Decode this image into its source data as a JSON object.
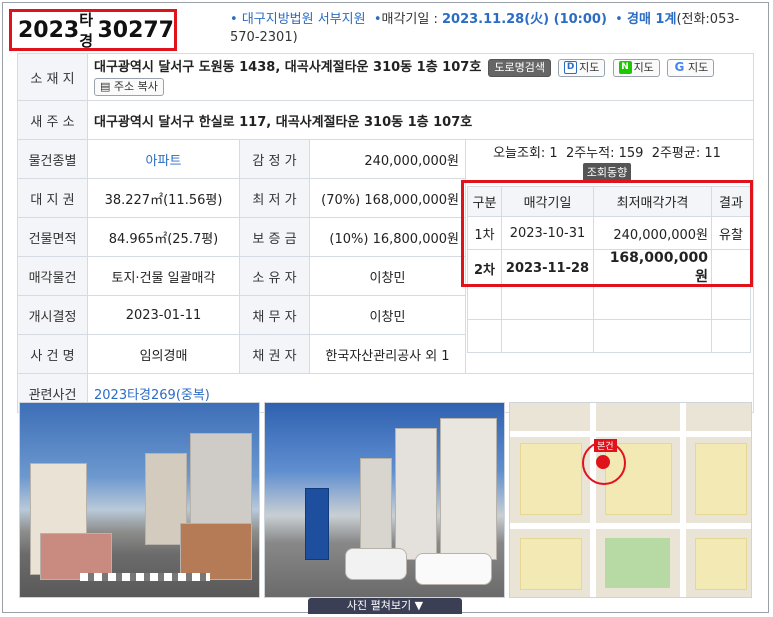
{
  "case": {
    "year": "2023",
    "type": "타경",
    "number": "30277"
  },
  "header": {
    "court": "대구지방법원 서부지원",
    "sale_date_label": "매각기일 : ",
    "sale_date": "2023.11.28(火) (10:00)",
    "dept": "경매 1계",
    "phone": "(전화:053-570-2301)"
  },
  "info": {
    "location_label": "소 재 지",
    "location": "대구광역시 달서구 도원동 1438, 대곡사계절타운 310동 1층 107호",
    "road_search_btn": "도로명검색",
    "map_d": "지도",
    "map_n": "지도",
    "map_g": "지도",
    "copy_btn": "주소 복사",
    "new_addr_label": "새 주 소",
    "new_addr": "대구광역시 달서구 한실로 117, 대곡사계절타운 310동 1층 107호",
    "kind_label": "물건종별",
    "kind": "아파트",
    "appraisal_label": "감 정 가",
    "appraisal": "240,000,000원",
    "land_label": "대 지 권",
    "land": "38.227㎡(11.56평)",
    "min_label": "최 저 가",
    "min": "(70%) 168,000,000원",
    "bldg_label": "건물면적",
    "bldg": "84.965㎡(25.7평)",
    "deposit_label": "보 증 금",
    "deposit": "(10%) 16,800,000원",
    "sale_item_label": "매각물건",
    "sale_item": "토지·건물 일괄매각",
    "owner_label": "소 유 자",
    "owner": "이창민",
    "start_label": "개시결정",
    "start": "2023-01-11",
    "debtor_label": "채 무 자",
    "debtor": "이창민",
    "case_name_label": "사 건 명",
    "case_name": "임의경매",
    "creditor_label": "채 권 자",
    "creditor": "한국자산관리공사 외 1",
    "related_label": "관련사건",
    "related": "2023타경269(중복)"
  },
  "stats": {
    "today": "오늘조회: 1",
    "two_week": "2주누적: 159",
    "avg": "2주평균: 11",
    "tag": "조회동향"
  },
  "sale_table": {
    "headers": [
      "구분",
      "매각기일",
      "최저매각가격",
      "결과"
    ],
    "rows": [
      [
        "1차",
        "2023-10-31",
        "240,000,000원",
        "유찰"
      ],
      [
        "2차",
        "2023-11-28",
        "168,000,000원",
        ""
      ]
    ]
  },
  "map": {
    "label": "본건"
  },
  "photo_button": "사진 펼쳐보기 ▼"
}
